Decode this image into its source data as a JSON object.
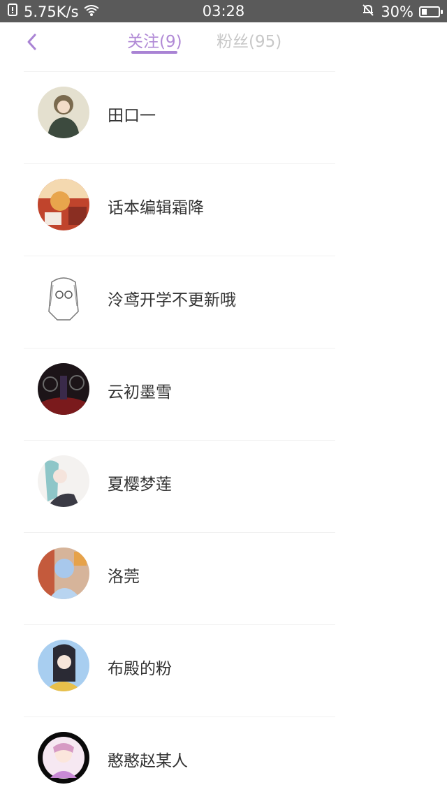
{
  "status_bar": {
    "speed": "5.75K/s",
    "time": "03:28",
    "battery": "30%",
    "battery_level": 0.3
  },
  "nav": {
    "back_icon": "chevron-left-icon",
    "tabs": [
      {
        "label": "关注(9)",
        "active": true
      },
      {
        "label": "粉丝(95)",
        "active": false
      }
    ]
  },
  "colors": {
    "accent": "#a983d4",
    "inactive_tab": "#c8c8c8",
    "status_bar": "#5a5a5a",
    "text": "#333333"
  },
  "following": [
    {
      "name": "田口一"
    },
    {
      "name": "话本编辑霜降"
    },
    {
      "name": "泠鸢开学不更新哦"
    },
    {
      "name": "云初墨雪"
    },
    {
      "name": "夏樱梦莲"
    },
    {
      "name": "洛莞"
    },
    {
      "name": "布殿的粉"
    },
    {
      "name": "憨憨赵某人"
    }
  ]
}
